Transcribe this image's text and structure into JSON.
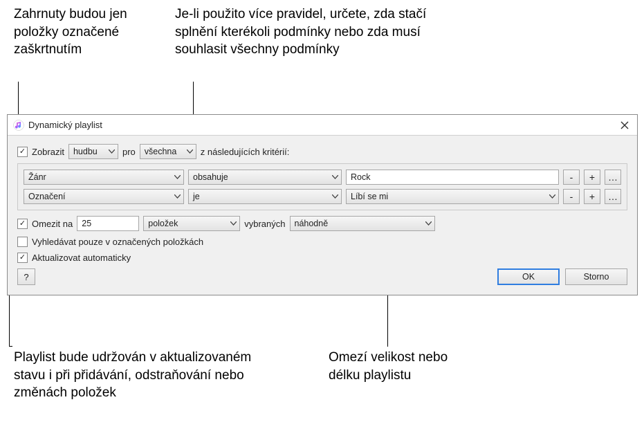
{
  "annotations": {
    "top_left": "Zahrnuty budou jen položky označené zaškrtnutím",
    "top_right": "Je-li použito více pravidel, určete, zda stačí splnění kterékoli podmínky nebo zda musí souhlasit všechny podmínky",
    "bottom_left": "Playlist bude udržován v aktualizovaném stavu i při přidávání, odstraňování nebo změnách položek",
    "bottom_right": "Omezí velikost nebo délku playlistu"
  },
  "dialog": {
    "title": "Dynamický playlist",
    "match": {
      "checkbox_checked": true,
      "show_label": "Zobrazit",
      "media_select": "hudbu",
      "for_label": "pro",
      "match_mode_select": "všechna",
      "criteria_label": "z následujících kritérií:"
    },
    "rules": [
      {
        "field": "Žánr",
        "op": "obsahuje",
        "value_type": "text",
        "value": "Rock"
      },
      {
        "field": "Označení",
        "op": "je",
        "value_type": "select",
        "value": "Líbí se mi"
      }
    ],
    "rule_buttons": {
      "minus": "-",
      "plus": "+",
      "more": "…"
    },
    "limit": {
      "checked": true,
      "label": "Omezit na",
      "value": "25",
      "unit_select": "položek",
      "selected_label": "vybraných",
      "method_select": "náhodně"
    },
    "only_checked": {
      "checked": false,
      "label": "Vyhledávat pouze v označených položkách"
    },
    "live_update": {
      "checked": true,
      "label": "Aktualizovat automaticky"
    },
    "buttons": {
      "help": "?",
      "ok": "OK",
      "cancel": "Storno"
    }
  }
}
